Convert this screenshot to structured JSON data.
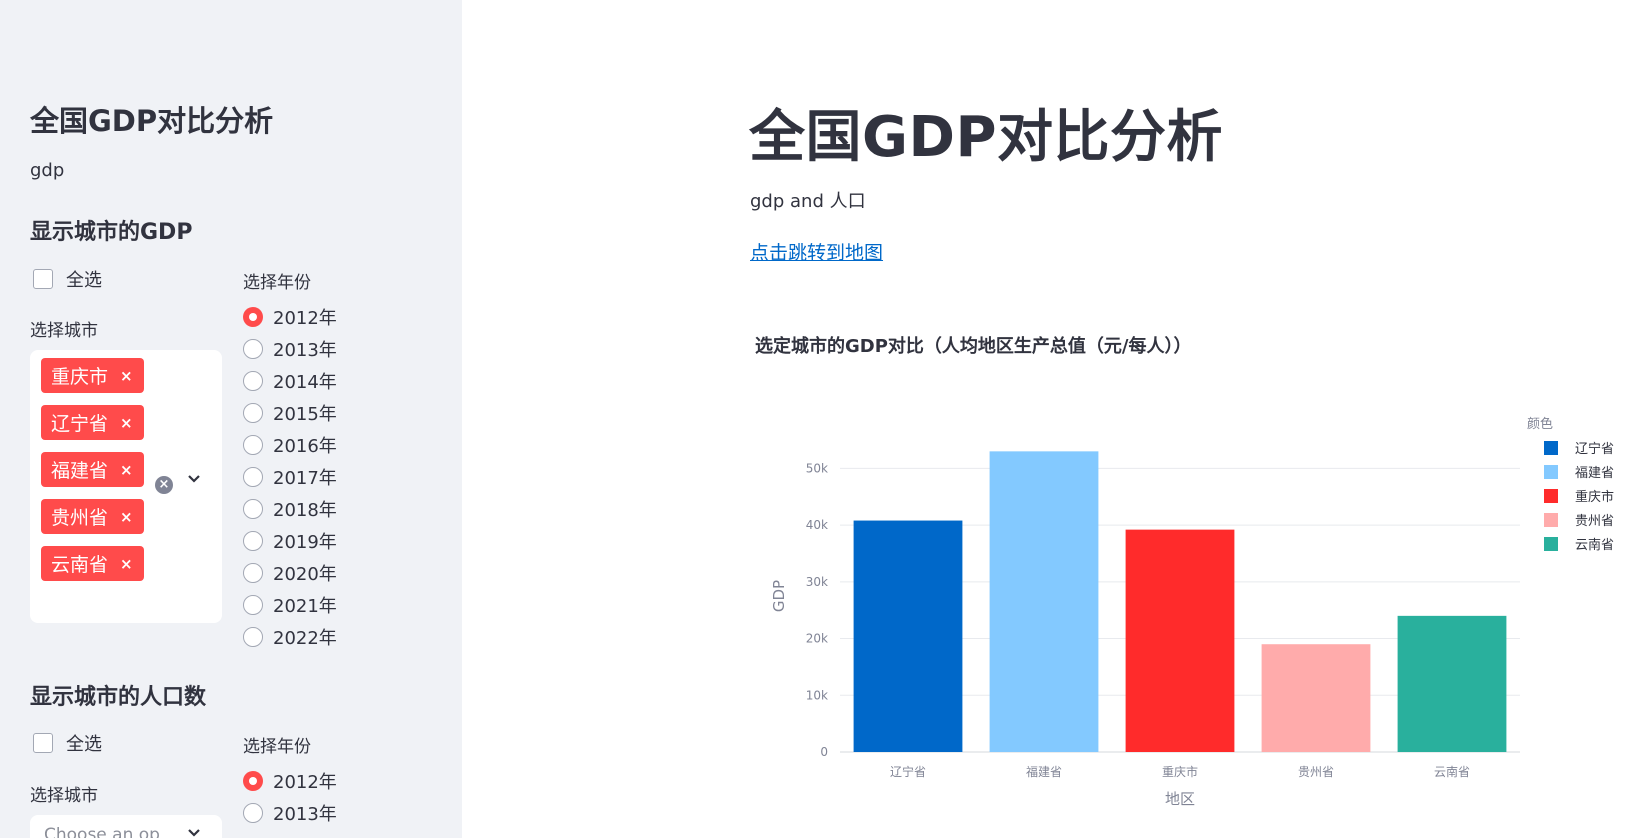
{
  "sidebar": {
    "title": "全国GDP对比分析",
    "text": "gdp",
    "gdp_section": {
      "heading": "显示城市的GDP",
      "select_all_label": "全选",
      "city_label": "选择城市",
      "selected_cities": [
        "重庆市",
        "辽宁省",
        "福建省",
        "贵州省",
        "云南省"
      ],
      "remove_icon": "×",
      "clear_icon": "×",
      "chevron_icon": "⌄",
      "year_label": "选择年份",
      "years": [
        "2012年",
        "2013年",
        "2014年",
        "2015年",
        "2016年",
        "2017年",
        "2018年",
        "2019年",
        "2020年",
        "2021年",
        "2022年"
      ],
      "selected_year": "2012年"
    },
    "population_section": {
      "heading": "显示城市的人口数",
      "select_all_label": "全选",
      "city_label": "选择城市",
      "city_placeholder": "Choose an op",
      "year_label": "选择年份",
      "years": [
        "2012年",
        "2013年"
      ],
      "selected_year": "2012年"
    }
  },
  "main": {
    "title": "全国GDP对比分析",
    "subtitle": "gdp and 人口",
    "link_text": "点击跳转到地图",
    "chart_title": "选定城市的GDP对比（人均地区生产总值（元/每人））"
  },
  "chart_data": {
    "type": "bar",
    "categories": [
      "辽宁省",
      "福建省",
      "重庆市",
      "贵州省",
      "云南省"
    ],
    "values": [
      40800,
      53000,
      39200,
      19000,
      24000
    ],
    "colors": [
      "#0068c9",
      "#83c9ff",
      "#ff2b2b",
      "#ffabab",
      "#29b09d"
    ],
    "xlabel": "地区",
    "ylabel": "GDP",
    "ylim": [
      0,
      55000
    ],
    "yticks": [
      0,
      10000,
      20000,
      30000,
      40000,
      50000
    ],
    "ytick_labels": [
      "0",
      "10k",
      "20k",
      "30k",
      "40k",
      "50k"
    ],
    "legend_title": "颜色",
    "legend_position": "right",
    "grid": true
  }
}
